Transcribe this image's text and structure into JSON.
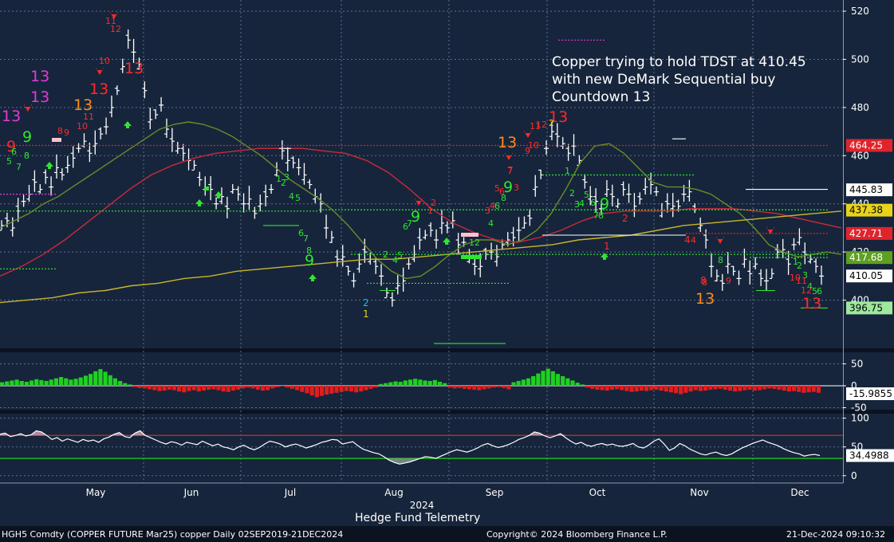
{
  "annotation": "Copper trying to hold TDST at 410.45 with new DeMark Sequential buy Countdown 13",
  "footer": {
    "title": "Hedge Fund Telemetry",
    "ticker_info": "HGH5 Comdty (COPPER FUTURE     Mar25) copper  Daily 02SEP2019-21DEC2024",
    "copyright": "Copyright© 2024 Bloomberg Finance L.P.",
    "timestamp": "21-Dec-2024 09:10:32"
  },
  "colors": {
    "background": "#16253b",
    "grid": "#5b6f8f",
    "price_bar": "#ffffff",
    "ma_fast": "#6b8c2a",
    "ma_mid": "#cc2a3a",
    "ma_slow": "#c9b52a",
    "buy_setup": "#2ee62e",
    "sell_setup": "#ff2a2a",
    "countdown_13": "#ff8c1a",
    "magenta_13": "#e23ad8",
    "hist_pos": "#1fd11f",
    "hist_neg": "#e01e1e"
  },
  "chart_data": [
    {
      "type": "candlestick",
      "panel": "price",
      "x_tick_labels": [
        "May",
        "Jun",
        "Jul",
        "Aug",
        "Sep",
        "Oct",
        "Nov",
        "Dec"
      ],
      "x_year_label": "2024",
      "ylim": [
        380,
        522
      ],
      "y_ticks": [
        400,
        420,
        440,
        460,
        480,
        500,
        520
      ],
      "price_labels": [
        {
          "value": 464.25,
          "text": "464.25",
          "color": "#e0242c",
          "text_color": "#ffffff"
        },
        {
          "value": 445.83,
          "text": "445.83",
          "color": "#ffffff",
          "text_color": "#000000"
        },
        {
          "value": 437.38,
          "text": "437.38",
          "color": "#e8d31a",
          "text_color": "#000000"
        },
        {
          "value": 427.71,
          "text": "427.71",
          "color": "#e0242c",
          "text_color": "#ffffff"
        },
        {
          "value": 417.68,
          "text": "417.68",
          "color": "#5ea020",
          "text_color": "#ffffff"
        },
        {
          "value": 410.05,
          "text": "410.05",
          "color": "#ffffff",
          "text_color": "#000000"
        },
        {
          "value": 396.75,
          "text": "396.75",
          "color": "#9ee89e",
          "text_color": "#000000"
        }
      ],
      "series": [
        {
          "name": "",
          "kind": "ohlc",
          "close": [
            431,
            433,
            430,
            437,
            441,
            444,
            449,
            446,
            451,
            447,
            455,
            452,
            456,
            459,
            463,
            466,
            461,
            465,
            469,
            472,
            480,
            487,
            497,
            508,
            503,
            498,
            487,
            475,
            477,
            481,
            471,
            466,
            463,
            461,
            458,
            456,
            450,
            447,
            446,
            440,
            443,
            438,
            446,
            444,
            440,
            442,
            436,
            440,
            443,
            446,
            454,
            462,
            458,
            457,
            455,
            452,
            448,
            443,
            440,
            430,
            426,
            417,
            418,
            412,
            408,
            415,
            420,
            417,
            414,
            410,
            403,
            400,
            406,
            408,
            415,
            419,
            425,
            427,
            429,
            425,
            432,
            430,
            433,
            423,
            424,
            418,
            414,
            414,
            419,
            420,
            418,
            423,
            425,
            426,
            429,
            432,
            434,
            447,
            452,
            463,
            470,
            468,
            465,
            461,
            464,
            458,
            449,
            443,
            441,
            438,
            446,
            443,
            440,
            446,
            444,
            439,
            442,
            447,
            448,
            445,
            437,
            440,
            439,
            439,
            444,
            445,
            438,
            431,
            425,
            414,
            410,
            407,
            415,
            412,
            409,
            417,
            411,
            415,
            409,
            408,
            411,
            420,
            421,
            415,
            423,
            426,
            419,
            417,
            414,
            410
          ]
        },
        {
          "name": "",
          "kind": "moving_average",
          "color": "#6b8c2a",
          "values": [
            430,
            433,
            436,
            440,
            443,
            447,
            451,
            455,
            459,
            463,
            467,
            471,
            473,
            474,
            473,
            471,
            468,
            464,
            460,
            455,
            450,
            446,
            442,
            437,
            431,
            424,
            417,
            412,
            409,
            410,
            414,
            419,
            423,
            425,
            425,
            423,
            425,
            429,
            436,
            446,
            457,
            464,
            465,
            461,
            455,
            449,
            447,
            447,
            446,
            444,
            440,
            436,
            430,
            423,
            420,
            418,
            419,
            420,
            419
          ]
        },
        {
          "name": "",
          "kind": "moving_average",
          "color": "#cc2a3a",
          "values": [
            410,
            414,
            419,
            425,
            432,
            439,
            446,
            452,
            456,
            459,
            461,
            462,
            463,
            463,
            463,
            462,
            461,
            458,
            453,
            446,
            438,
            432,
            428,
            425,
            424,
            426,
            429,
            433,
            436,
            437,
            437,
            437,
            438,
            438,
            438,
            437,
            436,
            434,
            432,
            430
          ]
        },
        {
          "name": "",
          "kind": "moving_average",
          "color": "#c9b52a",
          "values": [
            399,
            400,
            401,
            403,
            404,
            406,
            407,
            409,
            410,
            412,
            413,
            414,
            415,
            416,
            417,
            417,
            418,
            419,
            420,
            421,
            422,
            423,
            425,
            426,
            427,
            429,
            431,
            432,
            433,
            434,
            435,
            436,
            437
          ]
        }
      ],
      "annotations": [
        {
          "text": "13",
          "color": "#e23ad8"
        },
        {
          "text": "13",
          "color": "#e23ad8"
        },
        {
          "text": "13",
          "color": "#e23ad8"
        },
        {
          "text": "13",
          "color": "#ff8c1a"
        },
        {
          "text": "13",
          "color": "#ff2a2a"
        },
        {
          "text": "13",
          "color": "#ff2a2a"
        },
        {
          "text": "13",
          "color": "#ff8c1a"
        },
        {
          "text": "13",
          "color": "#ff2a2a"
        },
        {
          "text": "13",
          "color": "#ff8c1a"
        },
        {
          "text": "13",
          "color": "#ff2a2a"
        },
        {
          "text": "9",
          "color": "#2ee62e"
        },
        {
          "text": "9",
          "color": "#2ee62e"
        },
        {
          "text": "9",
          "color": "#2ee62e"
        },
        {
          "text": "9",
          "color": "#2ee62e"
        },
        {
          "text": "9",
          "color": "#2ee62e"
        },
        {
          "text": "9",
          "color": "#ff2a2a"
        },
        {
          "text": "1",
          "color": "#ff2a2a"
        },
        {
          "text": "2",
          "color": "#ff2a2a"
        },
        {
          "text": "4",
          "color": "#ff2a2a"
        },
        {
          "text": "7",
          "color": "#ff2a2a"
        },
        {
          "text": "8",
          "color": "#ff2a2a"
        },
        {
          "text": "2",
          "color": "#28b8e8"
        },
        {
          "text": "1",
          "color": "#e8d31a"
        }
      ]
    },
    {
      "type": "bar",
      "panel": "histogram",
      "y_ticks": [
        -50,
        0,
        50
      ],
      "ylim": [
        -60,
        60
      ],
      "last_value_label": "-15.9855",
      "series": [
        {
          "name": "",
          "values": [
            8,
            10,
            12,
            14,
            11,
            9,
            12,
            15,
            13,
            11,
            14,
            17,
            20,
            17,
            14,
            16,
            19,
            23,
            27,
            33,
            38,
            32,
            24,
            17,
            11,
            6,
            3,
            -3,
            -5,
            -6,
            -8,
            -10,
            -12,
            -11,
            -9,
            -10,
            -13,
            -15,
            -12,
            -10,
            -13,
            -11,
            -9,
            -8,
            -10,
            -13,
            -14,
            -11,
            -9,
            -6,
            -4,
            -6,
            -9,
            -11,
            -10,
            -6,
            -3,
            -1,
            -4,
            -7,
            -10,
            -14,
            -17,
            -22,
            -26,
            -23,
            -20,
            -18,
            -16,
            -14,
            -12,
            -13,
            -15,
            -13,
            -10,
            -7,
            -4,
            4,
            6,
            8,
            10,
            9,
            12,
            14,
            16,
            14,
            12,
            11,
            13,
            9,
            6,
            -4,
            -6,
            -5,
            -7,
            -8,
            -9,
            -10,
            -8,
            -6,
            -4,
            -3,
            -5,
            -8,
            8,
            11,
            14,
            17,
            22,
            28,
            34,
            39,
            33,
            27,
            22,
            17,
            12,
            7,
            3,
            -4,
            -7,
            -9,
            -10,
            -11,
            -9,
            -8,
            -10,
            -12,
            -14,
            -13,
            -11,
            -12,
            -10,
            -9,
            -11,
            -13,
            -15,
            -17,
            -19,
            -16,
            -13,
            -10,
            -12,
            -11,
            -9,
            -8,
            -7,
            -9,
            -11,
            -13,
            -12,
            -10,
            -9,
            -11,
            -10,
            -8,
            -6,
            -7,
            -9,
            -11,
            -13,
            -12,
            -14,
            -16,
            -15,
            -14,
            -16
          ]
        }
      ]
    },
    {
      "type": "line",
      "panel": "oscillator",
      "y_ticks": [
        0,
        50,
        100
      ],
      "ylim": [
        -10,
        105
      ],
      "reference_lines": [
        70,
        30
      ],
      "last_value_label": "34.4988",
      "series": [
        {
          "name": "",
          "values": [
            72,
            74,
            68,
            70,
            73,
            69,
            71,
            78,
            76,
            70,
            63,
            66,
            60,
            64,
            61,
            58,
            63,
            60,
            62,
            58,
            64,
            67,
            72,
            75,
            68,
            66,
            74,
            78,
            70,
            66,
            62,
            58,
            55,
            59,
            57,
            53,
            58,
            56,
            54,
            60,
            56,
            52,
            55,
            50,
            48,
            45,
            50,
            53,
            48,
            45,
            49,
            55,
            60,
            58,
            55,
            50,
            53,
            55,
            52,
            48,
            51,
            54,
            58,
            60,
            63,
            62,
            55,
            57,
            59,
            52,
            46,
            43,
            40,
            38,
            33,
            27,
            23,
            20,
            22,
            24,
            27,
            30,
            33,
            32,
            30,
            34,
            38,
            42,
            45,
            43,
            41,
            44,
            48,
            53,
            56,
            52,
            49,
            51,
            54,
            58,
            63,
            66,
            70,
            76,
            74,
            69,
            66,
            69,
            73,
            66,
            60,
            55,
            58,
            53,
            51,
            54,
            56,
            53,
            55,
            52,
            51,
            53,
            56,
            50,
            48,
            53,
            60,
            64,
            55,
            44,
            48,
            56,
            52,
            46,
            42,
            38,
            36,
            39,
            41,
            37,
            35,
            38,
            43,
            48,
            52,
            56,
            59,
            62,
            58,
            55,
            52,
            47,
            43,
            40,
            38,
            34,
            36,
            37,
            35
          ]
        }
      ]
    }
  ]
}
